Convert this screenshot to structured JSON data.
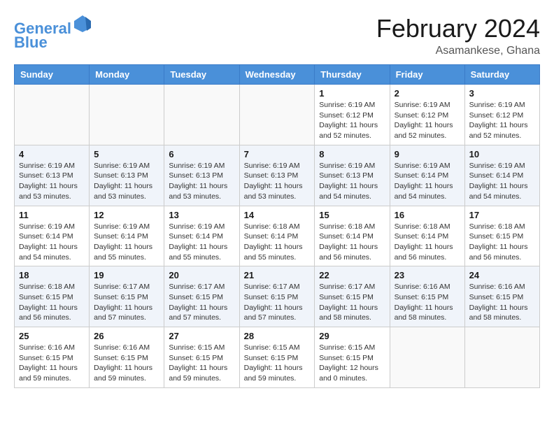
{
  "logo": {
    "line1": "General",
    "line2": "Blue"
  },
  "title": "February 2024",
  "location": "Asamankese, Ghana",
  "headers": [
    "Sunday",
    "Monday",
    "Tuesday",
    "Wednesday",
    "Thursday",
    "Friday",
    "Saturday"
  ],
  "weeks": [
    [
      {
        "day": "",
        "info": ""
      },
      {
        "day": "",
        "info": ""
      },
      {
        "day": "",
        "info": ""
      },
      {
        "day": "",
        "info": ""
      },
      {
        "day": "1",
        "info": "Sunrise: 6:19 AM\nSunset: 6:12 PM\nDaylight: 11 hours\nand 52 minutes."
      },
      {
        "day": "2",
        "info": "Sunrise: 6:19 AM\nSunset: 6:12 PM\nDaylight: 11 hours\nand 52 minutes."
      },
      {
        "day": "3",
        "info": "Sunrise: 6:19 AM\nSunset: 6:12 PM\nDaylight: 11 hours\nand 52 minutes."
      }
    ],
    [
      {
        "day": "4",
        "info": "Sunrise: 6:19 AM\nSunset: 6:13 PM\nDaylight: 11 hours\nand 53 minutes."
      },
      {
        "day": "5",
        "info": "Sunrise: 6:19 AM\nSunset: 6:13 PM\nDaylight: 11 hours\nand 53 minutes."
      },
      {
        "day": "6",
        "info": "Sunrise: 6:19 AM\nSunset: 6:13 PM\nDaylight: 11 hours\nand 53 minutes."
      },
      {
        "day": "7",
        "info": "Sunrise: 6:19 AM\nSunset: 6:13 PM\nDaylight: 11 hours\nand 53 minutes."
      },
      {
        "day": "8",
        "info": "Sunrise: 6:19 AM\nSunset: 6:13 PM\nDaylight: 11 hours\nand 54 minutes."
      },
      {
        "day": "9",
        "info": "Sunrise: 6:19 AM\nSunset: 6:14 PM\nDaylight: 11 hours\nand 54 minutes."
      },
      {
        "day": "10",
        "info": "Sunrise: 6:19 AM\nSunset: 6:14 PM\nDaylight: 11 hours\nand 54 minutes."
      }
    ],
    [
      {
        "day": "11",
        "info": "Sunrise: 6:19 AM\nSunset: 6:14 PM\nDaylight: 11 hours\nand 54 minutes."
      },
      {
        "day": "12",
        "info": "Sunrise: 6:19 AM\nSunset: 6:14 PM\nDaylight: 11 hours\nand 55 minutes."
      },
      {
        "day": "13",
        "info": "Sunrise: 6:19 AM\nSunset: 6:14 PM\nDaylight: 11 hours\nand 55 minutes."
      },
      {
        "day": "14",
        "info": "Sunrise: 6:18 AM\nSunset: 6:14 PM\nDaylight: 11 hours\nand 55 minutes."
      },
      {
        "day": "15",
        "info": "Sunrise: 6:18 AM\nSunset: 6:14 PM\nDaylight: 11 hours\nand 56 minutes."
      },
      {
        "day": "16",
        "info": "Sunrise: 6:18 AM\nSunset: 6:14 PM\nDaylight: 11 hours\nand 56 minutes."
      },
      {
        "day": "17",
        "info": "Sunrise: 6:18 AM\nSunset: 6:15 PM\nDaylight: 11 hours\nand 56 minutes."
      }
    ],
    [
      {
        "day": "18",
        "info": "Sunrise: 6:18 AM\nSunset: 6:15 PM\nDaylight: 11 hours\nand 56 minutes."
      },
      {
        "day": "19",
        "info": "Sunrise: 6:17 AM\nSunset: 6:15 PM\nDaylight: 11 hours\nand 57 minutes."
      },
      {
        "day": "20",
        "info": "Sunrise: 6:17 AM\nSunset: 6:15 PM\nDaylight: 11 hours\nand 57 minutes."
      },
      {
        "day": "21",
        "info": "Sunrise: 6:17 AM\nSunset: 6:15 PM\nDaylight: 11 hours\nand 57 minutes."
      },
      {
        "day": "22",
        "info": "Sunrise: 6:17 AM\nSunset: 6:15 PM\nDaylight: 11 hours\nand 58 minutes."
      },
      {
        "day": "23",
        "info": "Sunrise: 6:16 AM\nSunset: 6:15 PM\nDaylight: 11 hours\nand 58 minutes."
      },
      {
        "day": "24",
        "info": "Sunrise: 6:16 AM\nSunset: 6:15 PM\nDaylight: 11 hours\nand 58 minutes."
      }
    ],
    [
      {
        "day": "25",
        "info": "Sunrise: 6:16 AM\nSunset: 6:15 PM\nDaylight: 11 hours\nand 59 minutes."
      },
      {
        "day": "26",
        "info": "Sunrise: 6:16 AM\nSunset: 6:15 PM\nDaylight: 11 hours\nand 59 minutes."
      },
      {
        "day": "27",
        "info": "Sunrise: 6:15 AM\nSunset: 6:15 PM\nDaylight: 11 hours\nand 59 minutes."
      },
      {
        "day": "28",
        "info": "Sunrise: 6:15 AM\nSunset: 6:15 PM\nDaylight: 11 hours\nand 59 minutes."
      },
      {
        "day": "29",
        "info": "Sunrise: 6:15 AM\nSunset: 6:15 PM\nDaylight: 12 hours\nand 0 minutes."
      },
      {
        "day": "",
        "info": ""
      },
      {
        "day": "",
        "info": ""
      }
    ]
  ]
}
